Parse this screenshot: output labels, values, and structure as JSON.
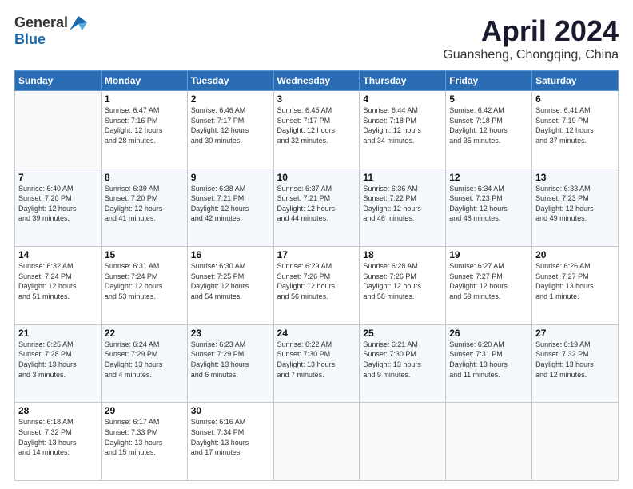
{
  "header": {
    "logo_general": "General",
    "logo_blue": "Blue",
    "title": "April 2024",
    "location": "Guansheng, Chongqing, China"
  },
  "days_of_week": [
    "Sunday",
    "Monday",
    "Tuesday",
    "Wednesday",
    "Thursday",
    "Friday",
    "Saturday"
  ],
  "weeks": [
    [
      {
        "day": "",
        "info": ""
      },
      {
        "day": "1",
        "info": "Sunrise: 6:47 AM\nSunset: 7:16 PM\nDaylight: 12 hours\nand 28 minutes."
      },
      {
        "day": "2",
        "info": "Sunrise: 6:46 AM\nSunset: 7:17 PM\nDaylight: 12 hours\nand 30 minutes."
      },
      {
        "day": "3",
        "info": "Sunrise: 6:45 AM\nSunset: 7:17 PM\nDaylight: 12 hours\nand 32 minutes."
      },
      {
        "day": "4",
        "info": "Sunrise: 6:44 AM\nSunset: 7:18 PM\nDaylight: 12 hours\nand 34 minutes."
      },
      {
        "day": "5",
        "info": "Sunrise: 6:42 AM\nSunset: 7:18 PM\nDaylight: 12 hours\nand 35 minutes."
      },
      {
        "day": "6",
        "info": "Sunrise: 6:41 AM\nSunset: 7:19 PM\nDaylight: 12 hours\nand 37 minutes."
      }
    ],
    [
      {
        "day": "7",
        "info": "Sunrise: 6:40 AM\nSunset: 7:20 PM\nDaylight: 12 hours\nand 39 minutes."
      },
      {
        "day": "8",
        "info": "Sunrise: 6:39 AM\nSunset: 7:20 PM\nDaylight: 12 hours\nand 41 minutes."
      },
      {
        "day": "9",
        "info": "Sunrise: 6:38 AM\nSunset: 7:21 PM\nDaylight: 12 hours\nand 42 minutes."
      },
      {
        "day": "10",
        "info": "Sunrise: 6:37 AM\nSunset: 7:21 PM\nDaylight: 12 hours\nand 44 minutes."
      },
      {
        "day": "11",
        "info": "Sunrise: 6:36 AM\nSunset: 7:22 PM\nDaylight: 12 hours\nand 46 minutes."
      },
      {
        "day": "12",
        "info": "Sunrise: 6:34 AM\nSunset: 7:23 PM\nDaylight: 12 hours\nand 48 minutes."
      },
      {
        "day": "13",
        "info": "Sunrise: 6:33 AM\nSunset: 7:23 PM\nDaylight: 12 hours\nand 49 minutes."
      }
    ],
    [
      {
        "day": "14",
        "info": "Sunrise: 6:32 AM\nSunset: 7:24 PM\nDaylight: 12 hours\nand 51 minutes."
      },
      {
        "day": "15",
        "info": "Sunrise: 6:31 AM\nSunset: 7:24 PM\nDaylight: 12 hours\nand 53 minutes."
      },
      {
        "day": "16",
        "info": "Sunrise: 6:30 AM\nSunset: 7:25 PM\nDaylight: 12 hours\nand 54 minutes."
      },
      {
        "day": "17",
        "info": "Sunrise: 6:29 AM\nSunset: 7:26 PM\nDaylight: 12 hours\nand 56 minutes."
      },
      {
        "day": "18",
        "info": "Sunrise: 6:28 AM\nSunset: 7:26 PM\nDaylight: 12 hours\nand 58 minutes."
      },
      {
        "day": "19",
        "info": "Sunrise: 6:27 AM\nSunset: 7:27 PM\nDaylight: 12 hours\nand 59 minutes."
      },
      {
        "day": "20",
        "info": "Sunrise: 6:26 AM\nSunset: 7:27 PM\nDaylight: 13 hours\nand 1 minute."
      }
    ],
    [
      {
        "day": "21",
        "info": "Sunrise: 6:25 AM\nSunset: 7:28 PM\nDaylight: 13 hours\nand 3 minutes."
      },
      {
        "day": "22",
        "info": "Sunrise: 6:24 AM\nSunset: 7:29 PM\nDaylight: 13 hours\nand 4 minutes."
      },
      {
        "day": "23",
        "info": "Sunrise: 6:23 AM\nSunset: 7:29 PM\nDaylight: 13 hours\nand 6 minutes."
      },
      {
        "day": "24",
        "info": "Sunrise: 6:22 AM\nSunset: 7:30 PM\nDaylight: 13 hours\nand 7 minutes."
      },
      {
        "day": "25",
        "info": "Sunrise: 6:21 AM\nSunset: 7:30 PM\nDaylight: 13 hours\nand 9 minutes."
      },
      {
        "day": "26",
        "info": "Sunrise: 6:20 AM\nSunset: 7:31 PM\nDaylight: 13 hours\nand 11 minutes."
      },
      {
        "day": "27",
        "info": "Sunrise: 6:19 AM\nSunset: 7:32 PM\nDaylight: 13 hours\nand 12 minutes."
      }
    ],
    [
      {
        "day": "28",
        "info": "Sunrise: 6:18 AM\nSunset: 7:32 PM\nDaylight: 13 hours\nand 14 minutes."
      },
      {
        "day": "29",
        "info": "Sunrise: 6:17 AM\nSunset: 7:33 PM\nDaylight: 13 hours\nand 15 minutes."
      },
      {
        "day": "30",
        "info": "Sunrise: 6:16 AM\nSunset: 7:34 PM\nDaylight: 13 hours\nand 17 minutes."
      },
      {
        "day": "",
        "info": ""
      },
      {
        "day": "",
        "info": ""
      },
      {
        "day": "",
        "info": ""
      },
      {
        "day": "",
        "info": ""
      }
    ]
  ]
}
